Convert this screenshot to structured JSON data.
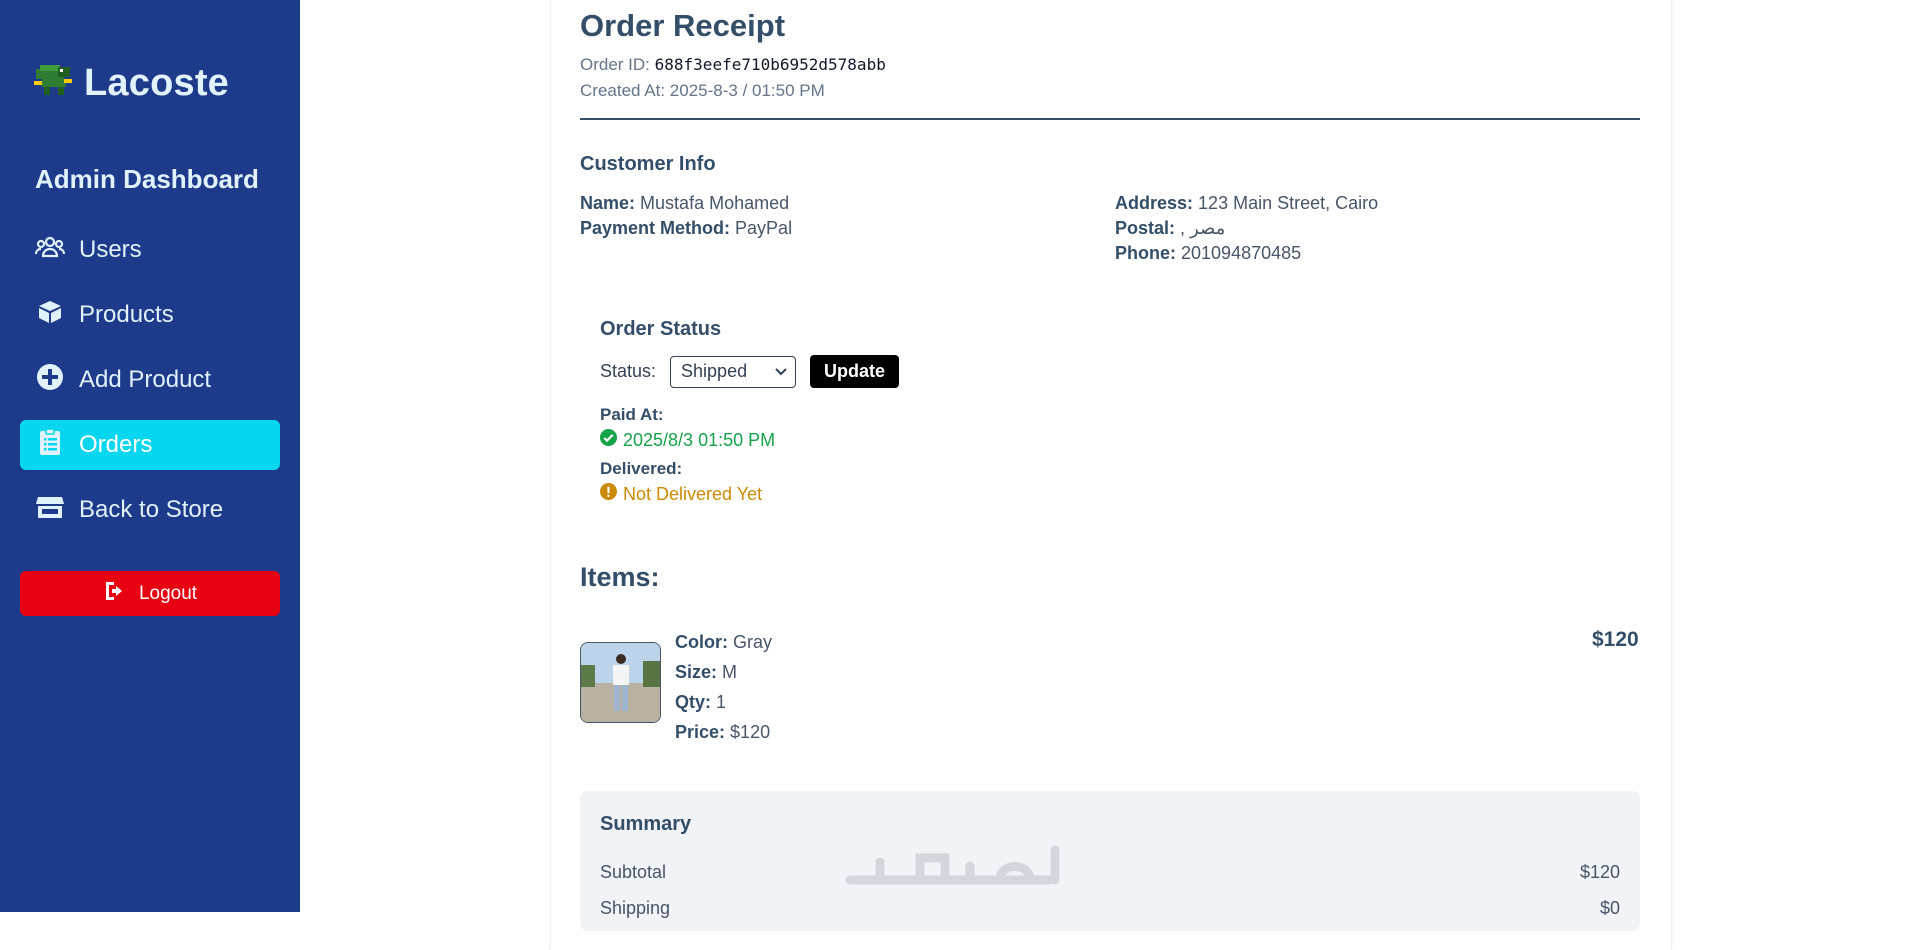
{
  "sidebar": {
    "brand": "Lacoste",
    "title": "Admin Dashboard",
    "items": [
      {
        "label": "Users",
        "icon": "users-icon",
        "active": false
      },
      {
        "label": "Products",
        "icon": "box-icon",
        "active": false
      },
      {
        "label": "Add Product",
        "icon": "plus-circle-icon",
        "active": false
      },
      {
        "label": "Orders",
        "icon": "clipboard-list-icon",
        "active": true
      },
      {
        "label": "Back to Store",
        "icon": "store-icon",
        "active": false
      }
    ],
    "logout": "Logout"
  },
  "receipt": {
    "title": "Order Receipt",
    "order_id_label": "Order ID:",
    "order_id": "688f3eefe710b6952d578abb",
    "created_label": "Created At:",
    "created": "2025-8-3 / 01:50 PM"
  },
  "customer": {
    "heading": "Customer Info",
    "name_label": "Name:",
    "name": "Mustafa Mohamed",
    "payment_label": "Payment Method:",
    "payment": "PayPal",
    "address_label": "Address:",
    "address": "123 Main Street, Cairo",
    "postal_label": "Postal:",
    "postal": ", مصر",
    "phone_label": "Phone:",
    "phone": "201094870485"
  },
  "order_status": {
    "heading": "Order Status",
    "status_label": "Status:",
    "selected": "Shipped",
    "update_label": "Update",
    "paid_label": "Paid At:",
    "paid_value": "2025/8/3 01:50 PM",
    "delivered_label": "Delivered:",
    "delivered_value": "Not Delivered Yet"
  },
  "items": {
    "heading": "Items:",
    "list": [
      {
        "color_label": "Color:",
        "color": "Gray",
        "size_label": "Size:",
        "size": "M",
        "qty_label": "Qty:",
        "qty": "1",
        "price_label": "Price:",
        "price": "$120",
        "total": "$120"
      }
    ]
  },
  "summary": {
    "heading": "Summary",
    "subtotal_label": "Subtotal",
    "subtotal": "$120",
    "shipping_label": "Shipping",
    "shipping": "$0"
  },
  "colors": {
    "sidebar_bg": "#1e3a8a",
    "active_item": "#06d6f0",
    "logout": "#e60012",
    "paid_green": "#16a34a",
    "pending_amber": "#ca8a04"
  }
}
